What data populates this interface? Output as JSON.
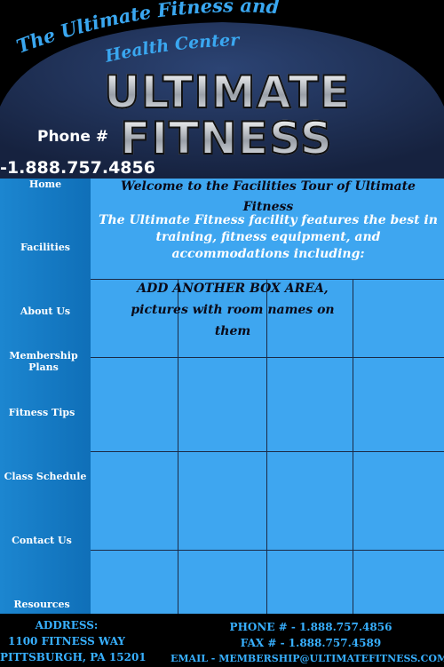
{
  "header": {
    "arc_title_line1": "The Ultimate Fitness and",
    "arc_title_line2": "Health Center",
    "logo_line1": "ULTIMATE",
    "logo_line2": "FITNESS",
    "phone_label": "Phone #",
    "phone_number": "1.888.757.4856",
    "colors": {
      "accent": "#3aa7f0",
      "dome": "#1f2f52",
      "background": "#000000"
    }
  },
  "sidebar": {
    "items": [
      {
        "label": "Home"
      },
      {
        "label": "Facilities"
      },
      {
        "label": "About Us"
      },
      {
        "label": "Membership Plans"
      },
      {
        "label": "Fitness Tips"
      },
      {
        "label": "Class Schedule"
      },
      {
        "label": "Contact Us"
      },
      {
        "label": "Resources"
      }
    ],
    "color": "#1c86d0"
  },
  "main": {
    "welcome": "Welcome to the Facilities Tour of Ultimate Fitness",
    "intro": "The Ultimate Fitness facility features the best in training, fitness equipment, and accommodations including:",
    "placeholder": "ADD ANOTHER BOX AREA, pictures with room names on them",
    "color": "#3ea6f0"
  },
  "footer": {
    "address_label": "ADDRESS:",
    "address_line1": "1100 FITNESS WAY",
    "address_line2": "PITTSBURGH, PA 15201",
    "phone": "PHONE # - 1.888.757.4856",
    "fax": "FAX # - 1.888.757.4589",
    "email": "EMAIL - MEMBERSHIP@ULTIMATEFITNESS.COM",
    "color": "#38b0ff"
  }
}
